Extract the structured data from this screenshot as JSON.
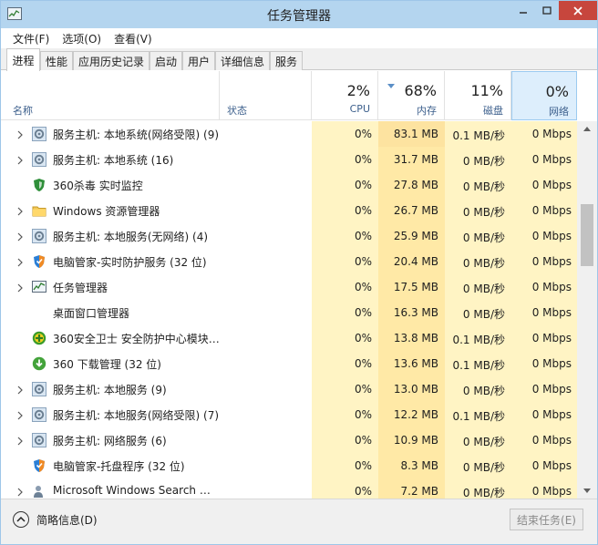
{
  "window": {
    "title": "任务管理器"
  },
  "menu": [
    "文件(F)",
    "选项(O)",
    "查看(V)"
  ],
  "tabs": [
    "进程",
    "性能",
    "应用历史记录",
    "启动",
    "用户",
    "详细信息",
    "服务"
  ],
  "columns": {
    "name": "名称",
    "status": "状态",
    "cpu": {
      "pct": "2%",
      "label": "CPU"
    },
    "memory": {
      "pct": "68%",
      "label": "内存"
    },
    "disk": {
      "pct": "11%",
      "label": "磁盘"
    },
    "network": {
      "pct": "0%",
      "label": "网络"
    }
  },
  "processes": [
    {
      "name": "服务主机: 本地系统(网络受限) (9)",
      "icon": "gear-icon",
      "expandable": true,
      "cpu": "0%",
      "memory": "83.1 MB",
      "disk": "0.1 MB/秒",
      "network": "0 Mbps"
    },
    {
      "name": "服务主机: 本地系统 (16)",
      "icon": "gear-icon",
      "expandable": true,
      "cpu": "0%",
      "memory": "31.7 MB",
      "disk": "0 MB/秒",
      "network": "0 Mbps"
    },
    {
      "name": "360杀毒 实时监控",
      "icon": "shield-icon",
      "expandable": false,
      "cpu": "0%",
      "memory": "27.8 MB",
      "disk": "0 MB/秒",
      "network": "0 Mbps"
    },
    {
      "name": "Windows 资源管理器",
      "icon": "folder-icon",
      "expandable": true,
      "cpu": "0%",
      "memory": "26.7 MB",
      "disk": "0 MB/秒",
      "network": "0 Mbps"
    },
    {
      "name": "服务主机: 本地服务(无网络) (4)",
      "icon": "gear-icon",
      "expandable": true,
      "cpu": "0%",
      "memory": "25.9 MB",
      "disk": "0 MB/秒",
      "network": "0 Mbps"
    },
    {
      "name": "电脑管家-实时防护服务 (32 位)",
      "icon": "guard-icon",
      "expandable": true,
      "cpu": "0%",
      "memory": "20.4 MB",
      "disk": "0 MB/秒",
      "network": "0 Mbps"
    },
    {
      "name": "任务管理器",
      "icon": "task-manager-icon",
      "expandable": true,
      "cpu": "0%",
      "memory": "17.5 MB",
      "disk": "0 MB/秒",
      "network": "0 Mbps"
    },
    {
      "name": "桌面窗口管理器",
      "icon": "window-icon",
      "expandable": false,
      "cpu": "0%",
      "memory": "16.3 MB",
      "disk": "0 MB/秒",
      "network": "0 Mbps"
    },
    {
      "name": "360安全卫士 安全防护中心模块…",
      "icon": "plus-shield-icon",
      "expandable": false,
      "cpu": "0%",
      "memory": "13.8 MB",
      "disk": "0.1 MB/秒",
      "network": "0 Mbps"
    },
    {
      "name": "360 下载管理 (32 位)",
      "icon": "download-icon",
      "expandable": false,
      "cpu": "0%",
      "memory": "13.6 MB",
      "disk": "0.1 MB/秒",
      "network": "0 Mbps"
    },
    {
      "name": "服务主机: 本地服务 (9)",
      "icon": "gear-icon",
      "expandable": true,
      "cpu": "0%",
      "memory": "13.0 MB",
      "disk": "0 MB/秒",
      "network": "0 Mbps"
    },
    {
      "name": "服务主机: 本地服务(网络受限) (7)",
      "icon": "gear-icon",
      "expandable": true,
      "cpu": "0%",
      "memory": "12.2 MB",
      "disk": "0.1 MB/秒",
      "network": "0 Mbps"
    },
    {
      "name": "服务主机: 网络服务 (6)",
      "icon": "gear-icon",
      "expandable": true,
      "cpu": "0%",
      "memory": "10.9 MB",
      "disk": "0 MB/秒",
      "network": "0 Mbps"
    },
    {
      "name": "电脑管家-托盘程序 (32 位)",
      "icon": "guard-icon",
      "expandable": false,
      "cpu": "0%",
      "memory": "8.3 MB",
      "disk": "0 MB/秒",
      "network": "0 Mbps"
    },
    {
      "name": "Microsoft Windows Search …",
      "icon": "search-person-icon",
      "expandable": true,
      "cpu": "0%",
      "memory": "7.2 MB",
      "disk": "0 MB/秒",
      "network": "0 Mbps"
    }
  ],
  "footer": {
    "fewer_details": "简略信息(D)",
    "end_task": "结束任务(E)"
  },
  "colors": {
    "cpu_heat": "#fff4c4",
    "memory_heat": "#ffe9a6",
    "memory_heat_top": "#fde3a0",
    "disk_heat": "#fff4c4",
    "network_heat": "#fff4c4",
    "network_selected": "#ddeefc"
  }
}
